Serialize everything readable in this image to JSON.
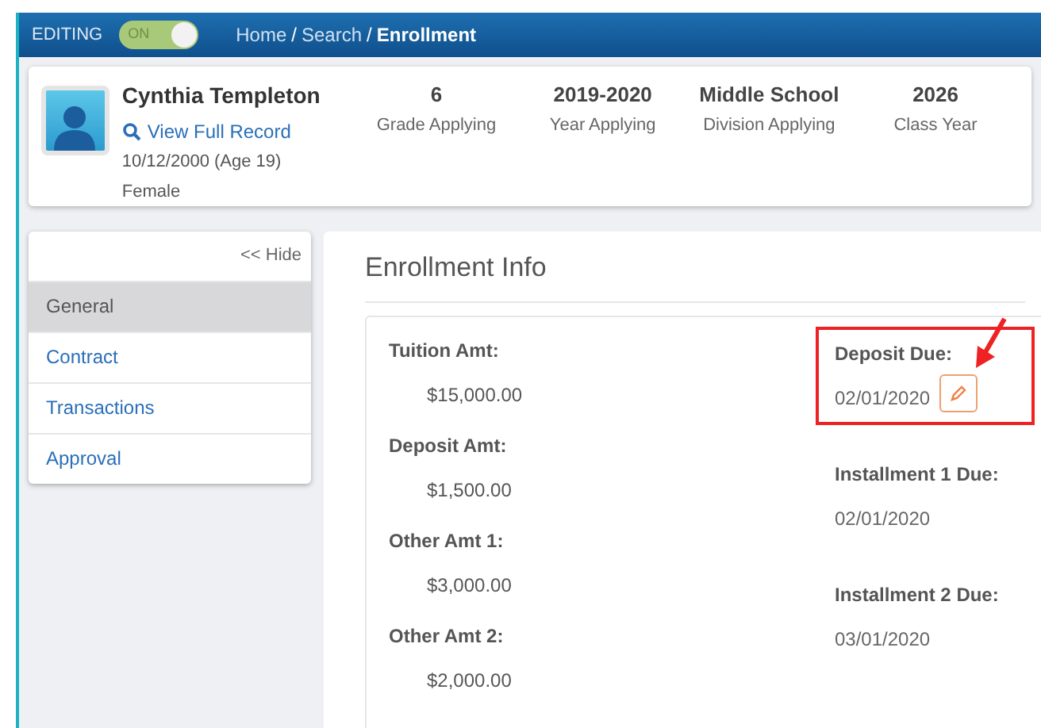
{
  "header": {
    "mode_label": "EDITING",
    "toggle": {
      "label": "ON",
      "on": true
    },
    "separator": "/",
    "breadcrumb": [
      {
        "label": "Home",
        "current": false
      },
      {
        "label": "Search",
        "current": false
      },
      {
        "label": "Enrollment",
        "current": true
      }
    ]
  },
  "profile": {
    "name": "Cynthia Templeton",
    "link": "View Full Record",
    "birth": "10/12/2000 (Age 19)",
    "gender": "Female",
    "stats": [
      {
        "value": "6",
        "label": "Grade Applying"
      },
      {
        "value": "2019-2020",
        "label": "Year Applying"
      },
      {
        "value": "Middle School",
        "label": "Division Applying"
      },
      {
        "value": "2026",
        "label": "Class Year"
      }
    ]
  },
  "sidebar": {
    "hide": "<< Hide",
    "items": [
      {
        "label": "General",
        "selected": true
      },
      {
        "label": "Contract",
        "selected": false
      },
      {
        "label": "Transactions",
        "selected": false
      },
      {
        "label": "Approval",
        "selected": false
      }
    ]
  },
  "main": {
    "title": "Enrollment Info",
    "left_fields": [
      {
        "label": "Tuition Amt:",
        "value": "$15,000.00"
      },
      {
        "label": "Deposit Amt:",
        "value": "$1,500.00"
      },
      {
        "label": "Other Amt 1:",
        "value": "$3,000.00"
      },
      {
        "label": "Other Amt 2:",
        "value": "$2,000.00"
      }
    ],
    "right_fields": [
      {
        "label": "Deposit Due:",
        "value": "02/01/2020",
        "editable": true,
        "highlighted": true
      },
      {
        "label": "Installment 1 Due:",
        "value": "02/01/2020",
        "editable": false,
        "highlighted": false
      },
      {
        "label": "Installment 2 Due:",
        "value": "03/01/2020",
        "editable": false,
        "highlighted": false
      }
    ]
  }
}
